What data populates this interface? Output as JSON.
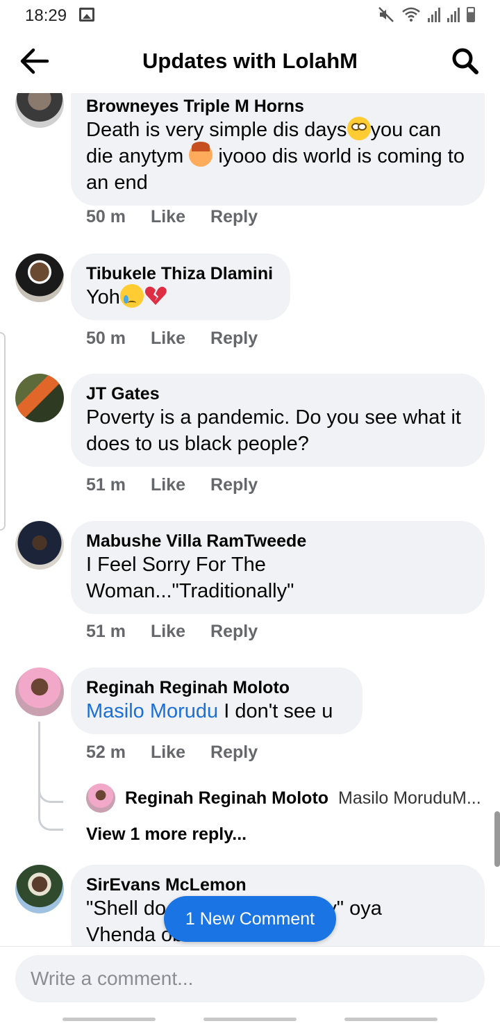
{
  "status_bar": {
    "time": "18:29"
  },
  "header": {
    "title": "Updates with LolahM"
  },
  "comments": [
    {
      "author": "Browneyes Triple M Horns",
      "text_parts": [
        "Death is very simple dis days",
        "you can die anytym ",
        " iyooo dis world is coming to an end"
      ],
      "time": "50 m",
      "like": "Like",
      "reply": "Reply"
    },
    {
      "author": "Tibukele Thiza Dlamini",
      "text_parts": [
        "Yoh"
      ],
      "time": "50 m",
      "like": "Like",
      "reply": "Reply"
    },
    {
      "author": "JT Gates",
      "text": "Poverty is a pandemic. Do you see what it does to us black people?",
      "time": "51 m",
      "like": "Like",
      "reply": "Reply"
    },
    {
      "author": "Mabushe Villa RamTweede",
      "text": "I Feel Sorry For The Woman...\"Traditionally\"",
      "time": "51 m",
      "like": "Like",
      "reply": "Reply"
    },
    {
      "author": "Reginah Reginah Moloto",
      "mention": "Masilo Morudu",
      "text": " I don't see u",
      "time": "52 m",
      "like": "Like",
      "reply": "Reply",
      "reply_preview": {
        "author": "Reginah Reginah Moloto",
        "text": "Masilo MoruduM..."
      },
      "view_more": "View 1 more reply..."
    },
    {
      "author": "SirEvans McLemon",
      "text_line1_start": "\"Shell do",
      "text_line1_end": "nally\" oya",
      "text_line2": "Vhenda obvious"
    }
  ],
  "new_comment_pill": "1 New Comment",
  "composer": {
    "placeholder": "Write a comment..."
  }
}
